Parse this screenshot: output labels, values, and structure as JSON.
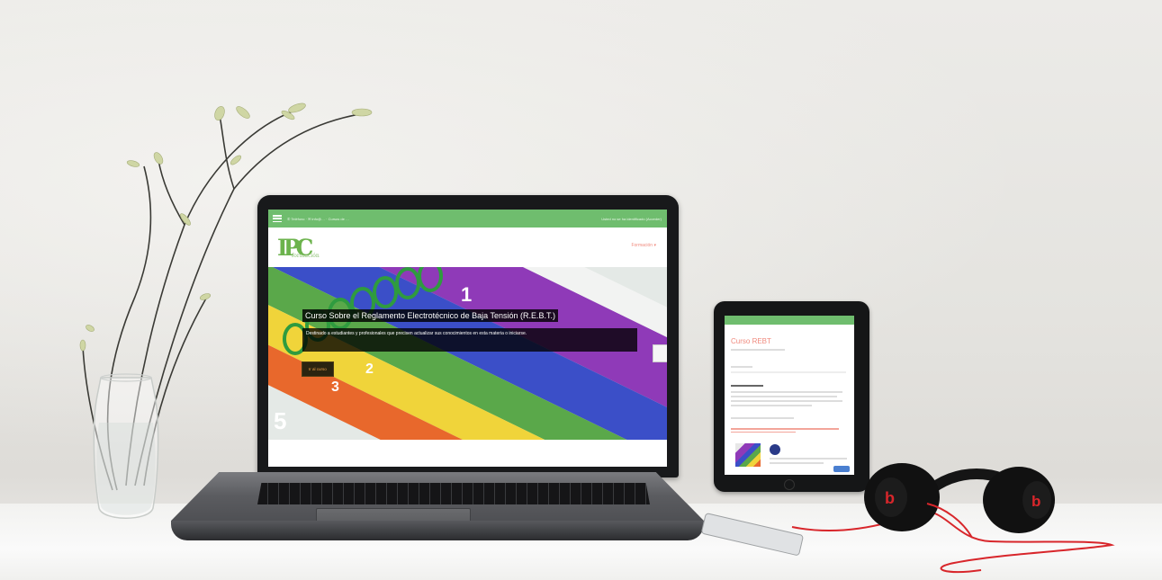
{
  "laptop_site": {
    "topbar": {
      "contact": "✆ Teléfono · ✉ info@… · Cursos de …",
      "login": "Usted no se ha identificado (Acceder)"
    },
    "logo": {
      "letters": "IPC",
      "wordmark": "formación"
    },
    "nav_link": "Formación ▾",
    "hero": {
      "title": "Curso Sobre el Reglamento Electrotécnico de Baja Tensión (R.E.B.T.)",
      "subtitle": "Destinado a estudiantes y profesionales que precisen actualizar sus conocimientos en esta materia o iniciarse.",
      "button": "Ir al curso",
      "binder_tab_numbers": [
        "1",
        "2",
        "3",
        "5"
      ]
    }
  },
  "tablet_site": {
    "page_title": "Curso REBT"
  },
  "colors": {
    "brand_green": "#6fbd6e",
    "accent_coral": "#f08a7e",
    "button_orange": "#f4a64a",
    "tabs": [
      "#8f3ab8",
      "#3b4fc8",
      "#5aa84a",
      "#f0d43a",
      "#e8682c"
    ]
  }
}
